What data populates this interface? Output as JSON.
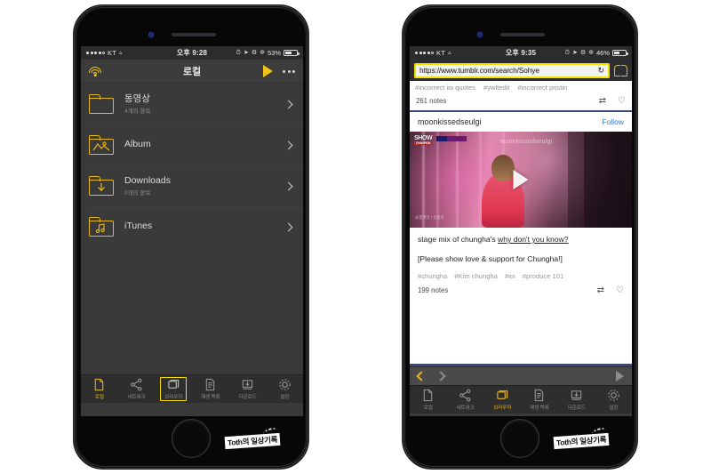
{
  "left_phone": {
    "status_bar": {
      "carrier": "KT",
      "time": "오후 9:28",
      "battery_percent": "53%",
      "battery_level": 53,
      "icons": [
        "signal-dots",
        "wifi-icon",
        "alarm-icon",
        "location-icon",
        "rotation-lock-icon",
        "bluetooth-icon"
      ]
    },
    "navbar": {
      "wifi_icon": "wifi-icon",
      "title": "로컬",
      "play_icon": "play-icon",
      "more_icon": "more-dots-icon"
    },
    "list": [
      {
        "icon": "folder-plain-icon",
        "title": "동영상",
        "subtitle": "4개의 항목"
      },
      {
        "icon": "folder-photo-icon",
        "title": "Album",
        "subtitle": ""
      },
      {
        "icon": "folder-download-icon",
        "title": "Downloads",
        "subtitle": "0개의 항목"
      },
      {
        "icon": "folder-music-icon",
        "title": "iTunes",
        "subtitle": ""
      }
    ],
    "tabbar": [
      {
        "icon": "document-icon",
        "label": "로컬",
        "active": true,
        "highlight": false
      },
      {
        "icon": "share-icon",
        "label": "네트워크",
        "active": false,
        "highlight": false
      },
      {
        "icon": "browser-icon",
        "label": "브라우저",
        "active": false,
        "highlight": true
      },
      {
        "icon": "playlist-icon",
        "label": "재생 목록",
        "active": false,
        "highlight": false
      },
      {
        "icon": "download-icon",
        "label": "다운로드",
        "active": false,
        "highlight": false
      },
      {
        "icon": "settings-icon",
        "label": "설정",
        "active": false,
        "highlight": false
      }
    ],
    "watermark": "Toth의 일상기록"
  },
  "right_phone": {
    "status_bar": {
      "carrier": "KT",
      "time": "오후 9:35",
      "battery_percent": "46%",
      "battery_level": 46,
      "icons": [
        "signal-dots",
        "wifi-icon",
        "alarm-icon",
        "location-icon",
        "rotation-lock-icon",
        "bluetooth-icon"
      ]
    },
    "urlbar": {
      "url": "https://www.tumblr.com/search/Sohye",
      "reload_icon": "reload-icon",
      "bookmark_icon": "bookmark-book-icon"
    },
    "web": {
      "top_post": {
        "tags": [
          "#incorrect ioi quotes",
          "#ywltedit",
          "#incorrect pristin"
        ],
        "notes": "261 notes",
        "reblog_icon": "reblog-icon",
        "like_icon": "heart-icon"
      },
      "post": {
        "username": "moonkissedseulgi",
        "follow_label": "Follow",
        "video": {
          "play_icon": "play-icon",
          "channel_logo": "SHOW",
          "channel_logo_sub": "CHAMPION",
          "overlay_watermark": "moonkissedseulgi",
          "corner_text": "쇼챔피언 / 김청하"
        },
        "body_line_1_prefix": "stage mix of chungha's ",
        "body_line_1_link": "why don't you know? ",
        "body_line_2": "[Please show love & support for Chungha!]",
        "tags": [
          "#chungha",
          "#Kim chungha",
          "#ioi",
          "#produce 101"
        ],
        "notes": "199 notes",
        "reblog_icon": "reblog-icon",
        "like_icon": "heart-icon"
      }
    },
    "browsernav": {
      "back_icon": "chevron-left-icon",
      "forward_icon": "chevron-right-icon",
      "play_icon": "play-icon"
    },
    "tabbar": [
      {
        "icon": "document-icon",
        "label": "로컬",
        "active": false,
        "highlight": false
      },
      {
        "icon": "share-icon",
        "label": "네트워크",
        "active": false,
        "highlight": false
      },
      {
        "icon": "browser-icon",
        "label": "브라우저",
        "active": true,
        "highlight": false
      },
      {
        "icon": "playlist-icon",
        "label": "재생 목록",
        "active": false,
        "highlight": false
      },
      {
        "icon": "download-icon",
        "label": "다운로드",
        "active": false,
        "highlight": false
      },
      {
        "icon": "settings-icon",
        "label": "설정",
        "active": false,
        "highlight": false
      }
    ],
    "watermark": "Toth의 일상기록"
  },
  "colors": {
    "accent_yellow": "#e8b81c",
    "highlight_yellow": "#f5e000",
    "app_bg": "#3a3a3a",
    "navbar_bg": "#3c3c3c",
    "tabbar_bg": "#2e2e2e",
    "link_blue": "#3a7bd0",
    "rule_navy": "#36477a"
  }
}
